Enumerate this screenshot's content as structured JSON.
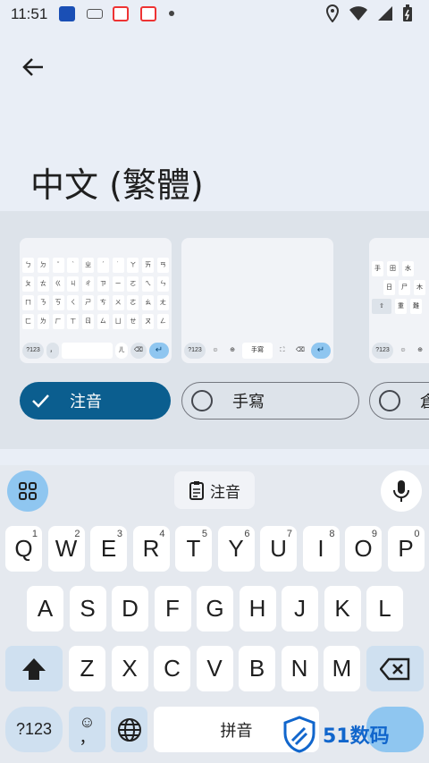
{
  "status_bar": {
    "time": "11:51",
    "icons": [
      "mobile-app-icon",
      "keyboard-icon",
      "location-app-icon",
      "location-app-icon",
      "dot-icon",
      "location-icon",
      "wifi-icon",
      "signal-icon",
      "battery-icon"
    ]
  },
  "app_bar": {
    "title": "中文 (繁體)"
  },
  "layout_cards": [
    {
      "name": "zhuyin",
      "rows": [
        [
          "ㄅ",
          "ㄉ",
          "ˇ",
          "ˋ",
          "ㄓ",
          "ˊ",
          "˙",
          "ㄚ",
          "ㄞ",
          "ㄢ"
        ],
        [
          "ㄆ",
          "ㄊ",
          "ㄍ",
          "ㄐ",
          "ㄔ",
          "ㄗ",
          "ㄧ",
          "ㄛ",
          "ㄟ",
          "ㄣ"
        ],
        [
          "ㄇ",
          "ㄋ",
          "ㄎ",
          "ㄑ",
          "ㄕ",
          "ㄘ",
          "ㄨ",
          "ㄜ",
          "ㄠ",
          "ㄤ"
        ],
        [
          "ㄈ",
          "ㄌ",
          "ㄏ",
          "ㄒ",
          "ㄖ",
          "ㄙ",
          "ㄩ",
          "ㄝ",
          "ㄡ",
          "ㄥ"
        ]
      ],
      "bottom": [
        "?123",
        "，",
        "ㄦ"
      ]
    },
    {
      "name": "handwriting",
      "bottom": [
        "?123",
        "手寫"
      ]
    },
    {
      "name": "cangjie",
      "rows": [
        [
          "手",
          "田",
          "水"
        ],
        [
          "日",
          "尸",
          "木"
        ],
        [
          "重",
          "難"
        ]
      ],
      "bottom": [
        "?123"
      ]
    }
  ],
  "chips": [
    {
      "label": "注音",
      "selected": true
    },
    {
      "label": "手寫",
      "selected": false
    },
    {
      "label": "倉",
      "selected": false
    }
  ],
  "keyboard": {
    "lang_label": "注音",
    "row1": [
      {
        "k": "Q",
        "h": "1"
      },
      {
        "k": "W",
        "h": "2"
      },
      {
        "k": "E",
        "h": "3"
      },
      {
        "k": "R",
        "h": "4"
      },
      {
        "k": "T",
        "h": "5"
      },
      {
        "k": "Y",
        "h": "6"
      },
      {
        "k": "U",
        "h": "7"
      },
      {
        "k": "I",
        "h": "8"
      },
      {
        "k": "O",
        "h": "9"
      },
      {
        "k": "P",
        "h": "0"
      }
    ],
    "row2": [
      "A",
      "S",
      "D",
      "F",
      "G",
      "H",
      "J",
      "K",
      "L"
    ],
    "row3": [
      "Z",
      "X",
      "C",
      "V",
      "B",
      "N",
      "M"
    ],
    "symbols_label": "?123",
    "comma_label": "，",
    "space_label": "拼音"
  },
  "watermark": {
    "text": "51数码"
  },
  "colors": {
    "accent": "#0b5e8f",
    "background": "#e9eef6",
    "key_dark": "#cfe0f0"
  }
}
